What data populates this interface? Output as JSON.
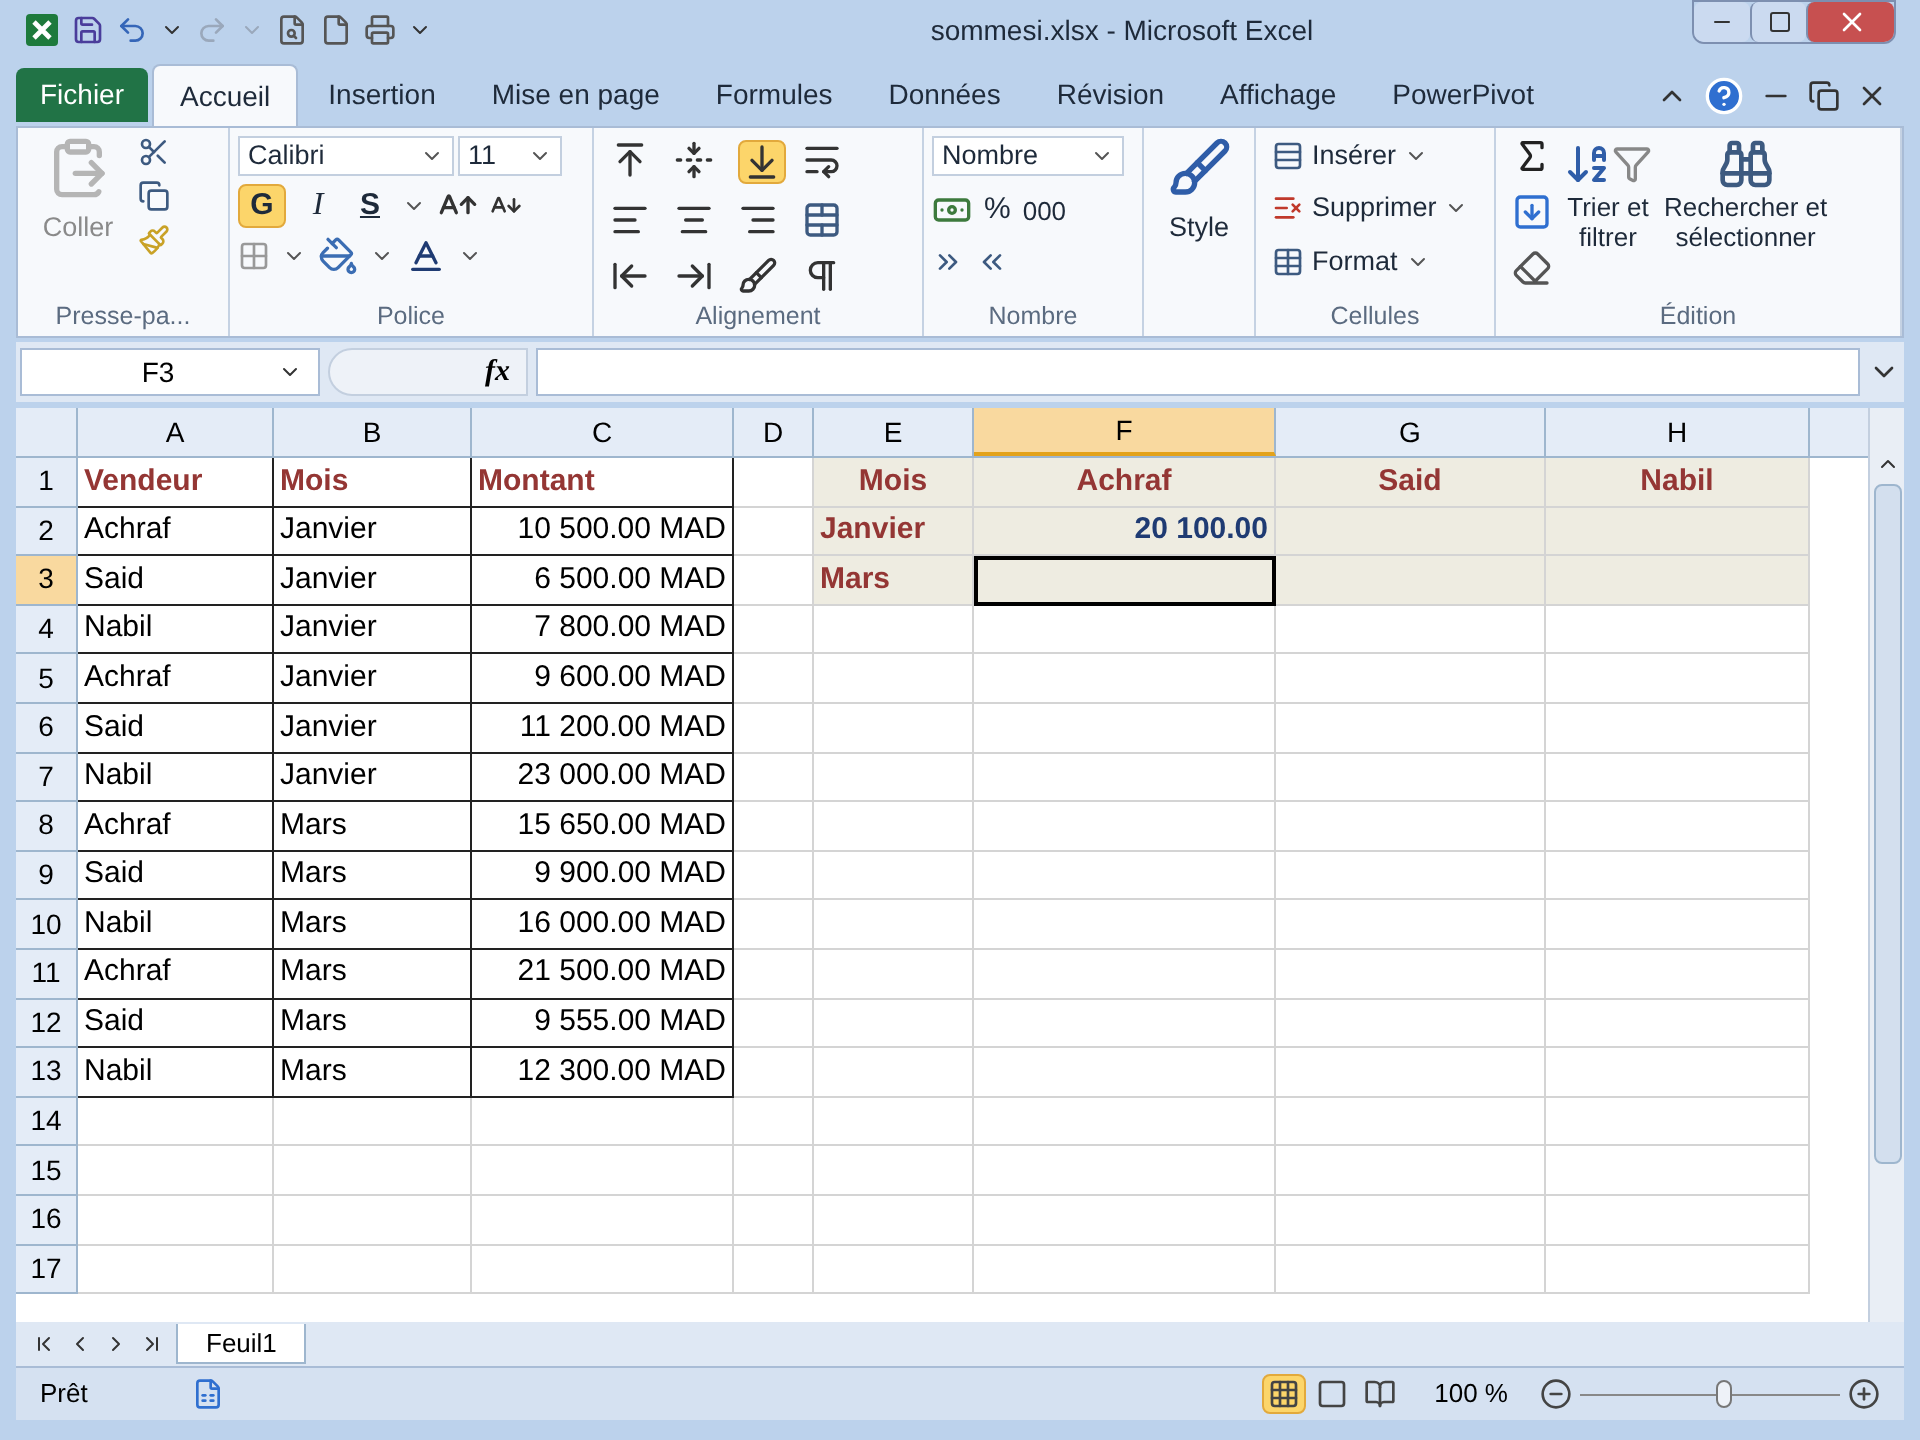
{
  "window": {
    "title": "sommesi.xlsx - Microsoft Excel"
  },
  "file_tab": "Fichier",
  "tabs": [
    {
      "label": "Accueil",
      "selected": true
    },
    {
      "label": "Insertion",
      "selected": false
    },
    {
      "label": "Mise en page",
      "selected": false
    },
    {
      "label": "Formules",
      "selected": false
    },
    {
      "label": "Données",
      "selected": false
    },
    {
      "label": "Révision",
      "selected": false
    },
    {
      "label": "Affichage",
      "selected": false
    },
    {
      "label": "PowerPivot",
      "selected": false
    }
  ],
  "clipboard": {
    "paste": "Coller",
    "label": "Presse-pa..."
  },
  "font": {
    "name": "Calibri",
    "size": "11",
    "bold": "G",
    "italic": "I",
    "underline": "S",
    "bold_on": true,
    "label": "Police"
  },
  "alignment": {
    "bottom_on": true,
    "label": "Alignement"
  },
  "number": {
    "format": "Nombre",
    "percent": "%",
    "thousands": "000",
    "label": "Nombre"
  },
  "style": {
    "label": "Style"
  },
  "cells_group": {
    "insert": "Insérer",
    "delete": "Supprimer",
    "format": "Format",
    "label": "Cellules"
  },
  "editing": {
    "sort": [
      "Trier et",
      "filtrer"
    ],
    "find": [
      "Rechercher et",
      "sélectionner"
    ],
    "label": "Édition"
  },
  "formula_bar": {
    "name_box": "F3",
    "fx": "fx"
  },
  "columns": [
    {
      "label": "A",
      "selected": false
    },
    {
      "label": "B",
      "selected": false
    },
    {
      "label": "C",
      "selected": false
    },
    {
      "label": "D",
      "selected": false
    },
    {
      "label": "E",
      "selected": false
    },
    {
      "label": "F",
      "selected": true
    },
    {
      "label": "G",
      "selected": false
    },
    {
      "label": "H",
      "selected": false
    }
  ],
  "rows": [
    {
      "label": "1",
      "selected": false,
      "cells": [
        {
          "kind": "header",
          "text": "Vendeur"
        },
        {
          "kind": "header",
          "text": "Mois"
        },
        {
          "kind": "header",
          "text": "Montant"
        },
        {
          "kind": "blank"
        },
        {
          "kind": "header_center",
          "text": "Mois"
        },
        {
          "kind": "header_center",
          "text": "Achraf"
        },
        {
          "kind": "header_center",
          "text": "Said"
        },
        {
          "kind": "header_center",
          "text": "Nabil"
        }
      ]
    },
    {
      "label": "2",
      "selected": false,
      "cells": [
        {
          "kind": "text",
          "text": "Achraf"
        },
        {
          "kind": "text",
          "text": "Janvier"
        },
        {
          "kind": "amount",
          "text": "10 500.00 MAD"
        },
        {
          "kind": "blank"
        },
        {
          "kind": "row_label",
          "text": "Janvier"
        },
        {
          "kind": "total",
          "text": "20 100.00"
        },
        {
          "kind": "band"
        },
        {
          "kind": "band"
        }
      ]
    },
    {
      "label": "3",
      "selected": true,
      "cells": [
        {
          "kind": "text",
          "text": "Said"
        },
        {
          "kind": "text",
          "text": "Janvier"
        },
        {
          "kind": "amount",
          "text": "6 500.00 MAD"
        },
        {
          "kind": "blank"
        },
        {
          "kind": "row_label",
          "text": "Mars"
        },
        {
          "kind": "band"
        },
        {
          "kind": "band"
        },
        {
          "kind": "band"
        }
      ]
    },
    {
      "label": "4",
      "selected": false,
      "cells": [
        {
          "kind": "text",
          "text": "Nabil"
        },
        {
          "kind": "text",
          "text": "Janvier"
        },
        {
          "kind": "amount",
          "text": "7 800.00 MAD"
        }
      ]
    },
    {
      "label": "5",
      "selected": false,
      "cells": [
        {
          "kind": "text",
          "text": "Achraf"
        },
        {
          "kind": "text",
          "text": "Janvier"
        },
        {
          "kind": "amount",
          "text": "9 600.00 MAD"
        }
      ]
    },
    {
      "label": "6",
      "selected": false,
      "cells": [
        {
          "kind": "text",
          "text": "Said"
        },
        {
          "kind": "text",
          "text": "Janvier"
        },
        {
          "kind": "amount",
          "text": "11 200.00 MAD"
        }
      ]
    },
    {
      "label": "7",
      "selected": false,
      "cells": [
        {
          "kind": "text",
          "text": "Nabil"
        },
        {
          "kind": "text",
          "text": "Janvier"
        },
        {
          "kind": "amount",
          "text": "23 000.00 MAD"
        }
      ]
    },
    {
      "label": "8",
      "selected": false,
      "cells": [
        {
          "kind": "text",
          "text": "Achraf"
        },
        {
          "kind": "text",
          "text": "Mars"
        },
        {
          "kind": "amount",
          "text": "15 650.00 MAD"
        }
      ]
    },
    {
      "label": "9",
      "selected": false,
      "cells": [
        {
          "kind": "text",
          "text": "Said"
        },
        {
          "kind": "text",
          "text": "Mars"
        },
        {
          "kind": "amount",
          "text": "9 900.00 MAD"
        }
      ]
    },
    {
      "label": "10",
      "selected": false,
      "cells": [
        {
          "kind": "text",
          "text": "Nabil"
        },
        {
          "kind": "text",
          "text": "Mars"
        },
        {
          "kind": "amount",
          "text": "16 000.00 MAD"
        }
      ]
    },
    {
      "label": "11",
      "selected": false,
      "cells": [
        {
          "kind": "text",
          "text": "Achraf"
        },
        {
          "kind": "text",
          "text": "Mars"
        },
        {
          "kind": "amount",
          "text": "21 500.00 MAD"
        }
      ]
    },
    {
      "label": "12",
      "selected": false,
      "cells": [
        {
          "kind": "text",
          "text": "Said"
        },
        {
          "kind": "text",
          "text": "Mars"
        },
        {
          "kind": "amount",
          "text": "9 555.00 MAD"
        }
      ]
    },
    {
      "label": "13",
      "selected": false,
      "cells": [
        {
          "kind": "text",
          "text": "Nabil"
        },
        {
          "kind": "text",
          "text": "Mars"
        },
        {
          "kind": "amount",
          "text": "12 300.00 MAD"
        }
      ]
    },
    {
      "label": "14",
      "selected": false
    },
    {
      "label": "15",
      "selected": false
    },
    {
      "label": "16",
      "selected": false
    },
    {
      "label": "17",
      "selected": false
    }
  ],
  "sheet_tabs": [
    {
      "label": "Feuil1",
      "selected": true
    }
  ],
  "status_bar": {
    "status": "Prêt",
    "views": [
      {
        "kind": "normal",
        "selected": true
      },
      {
        "kind": "layout",
        "selected": false
      },
      {
        "kind": "break",
        "selected": false
      }
    ],
    "zoom": "100 %",
    "zoom_slider": {
      "level": 0.55
    }
  }
}
